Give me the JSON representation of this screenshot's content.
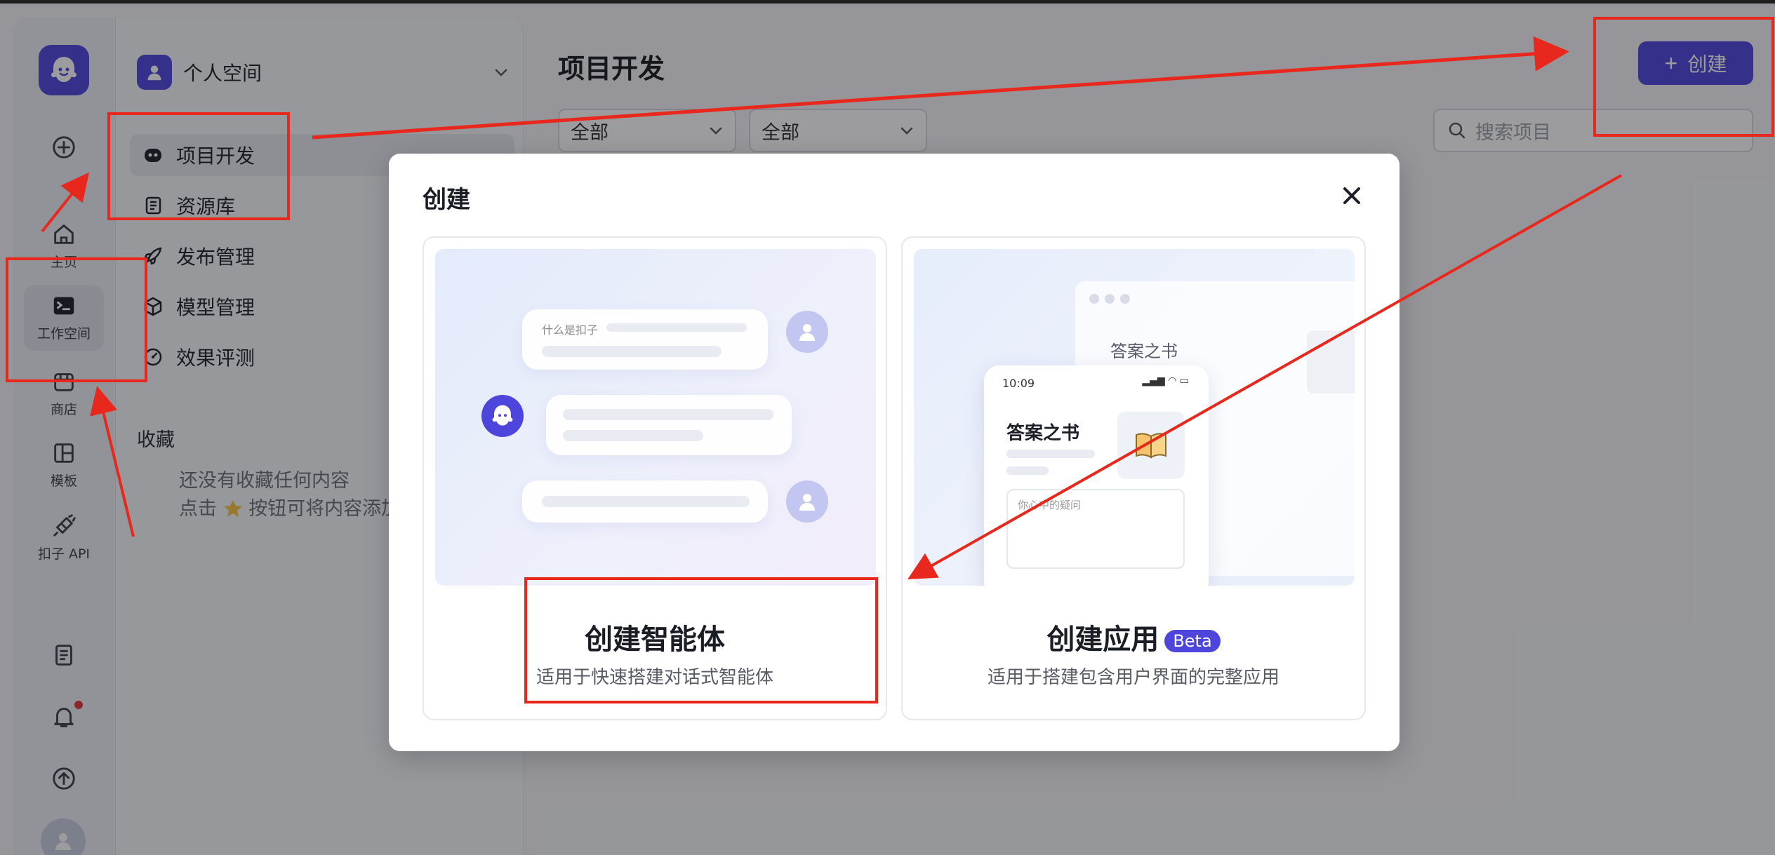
{
  "rail": {
    "items": [
      {
        "label": "",
        "icon": "add-circle-icon"
      },
      {
        "label": "主页",
        "icon": "home-icon"
      },
      {
        "label": "工作空间",
        "icon": "terminal-icon"
      },
      {
        "label": "商店",
        "icon": "store-icon"
      },
      {
        "label": "模板",
        "icon": "template-icon"
      },
      {
        "label": "扣子 API",
        "icon": "plug-icon"
      }
    ]
  },
  "space": {
    "name": "个人空间"
  },
  "nav": [
    {
      "label": "项目开发",
      "icon": "bot-icon"
    },
    {
      "label": "资源库",
      "icon": "library-icon"
    },
    {
      "label": "发布管理",
      "icon": "rocket-icon"
    },
    {
      "label": "模型管理",
      "icon": "cube-icon"
    },
    {
      "label": "效果评测",
      "icon": "gauge-icon"
    }
  ],
  "favorites": {
    "title": "收藏",
    "empty_line1": "还没有收藏任何内容",
    "empty_line2_before": "点击",
    "empty_line2_after": "按钮可将内容添加"
  },
  "main": {
    "title": "项目开发",
    "filter1": "全部",
    "filter2": "全部",
    "search_placeholder": "搜索项目",
    "create_label": "创建"
  },
  "modal": {
    "title": "创建",
    "agent_card": {
      "title": "创建智能体",
      "subtitle": "适用于快速搭建对话式智能体",
      "chat_question": "什么是扣子"
    },
    "app_card": {
      "title": "创建应用",
      "badge": "Beta",
      "subtitle": "适用于搭建包含用户界面的完整应用",
      "app_name": "答案之书",
      "phone_time": "10:09",
      "input_placeholder": "你心中的疑问"
    }
  },
  "colors": {
    "accent": "#4e46dc",
    "annotation": "#e8281c"
  }
}
